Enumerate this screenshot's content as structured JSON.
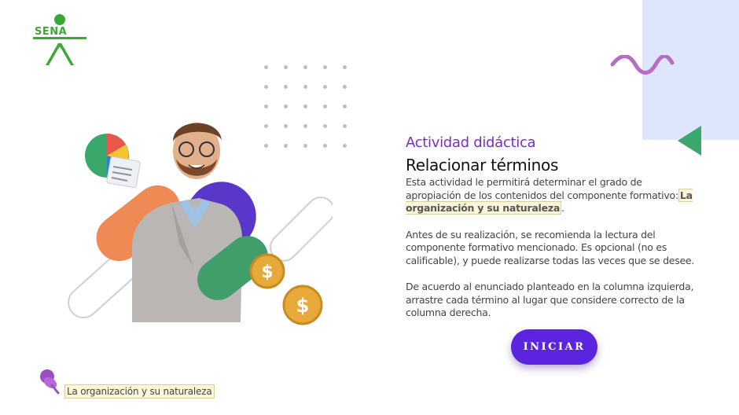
{
  "logo": {
    "text": "SENA",
    "color": "#39a935"
  },
  "activity": {
    "subtitle": "Actividad didáctica",
    "title": "Relacionar términos",
    "p1_text": "Esta actividad le permitirá determinar el grado de apropiación de los contenidos del componente formativo:",
    "p1_highlight": "La organización y su naturaleza",
    "p1_end": ".",
    "p2": "Antes de su realización, se recomienda la lectura del componente formativo mencionado.  Es opcional (no es calificable), y puede realizarse todas las veces que se desee.",
    "p3": "De acuerdo al enunciado planteado en la columna izquierda, arrastre cada término al lugar que considere correcto de la columna derecha."
  },
  "button": {
    "label": "INICIAR"
  },
  "footer": {
    "label": "La organización y su naturaleza",
    "icon": "pushpin-icon"
  },
  "colors": {
    "accent_purple": "#7a2ec7",
    "button": "#5b25e0",
    "decor_green": "#3aa86b",
    "decor_blue": "#dde6fb",
    "wave": "#b86bc9"
  }
}
